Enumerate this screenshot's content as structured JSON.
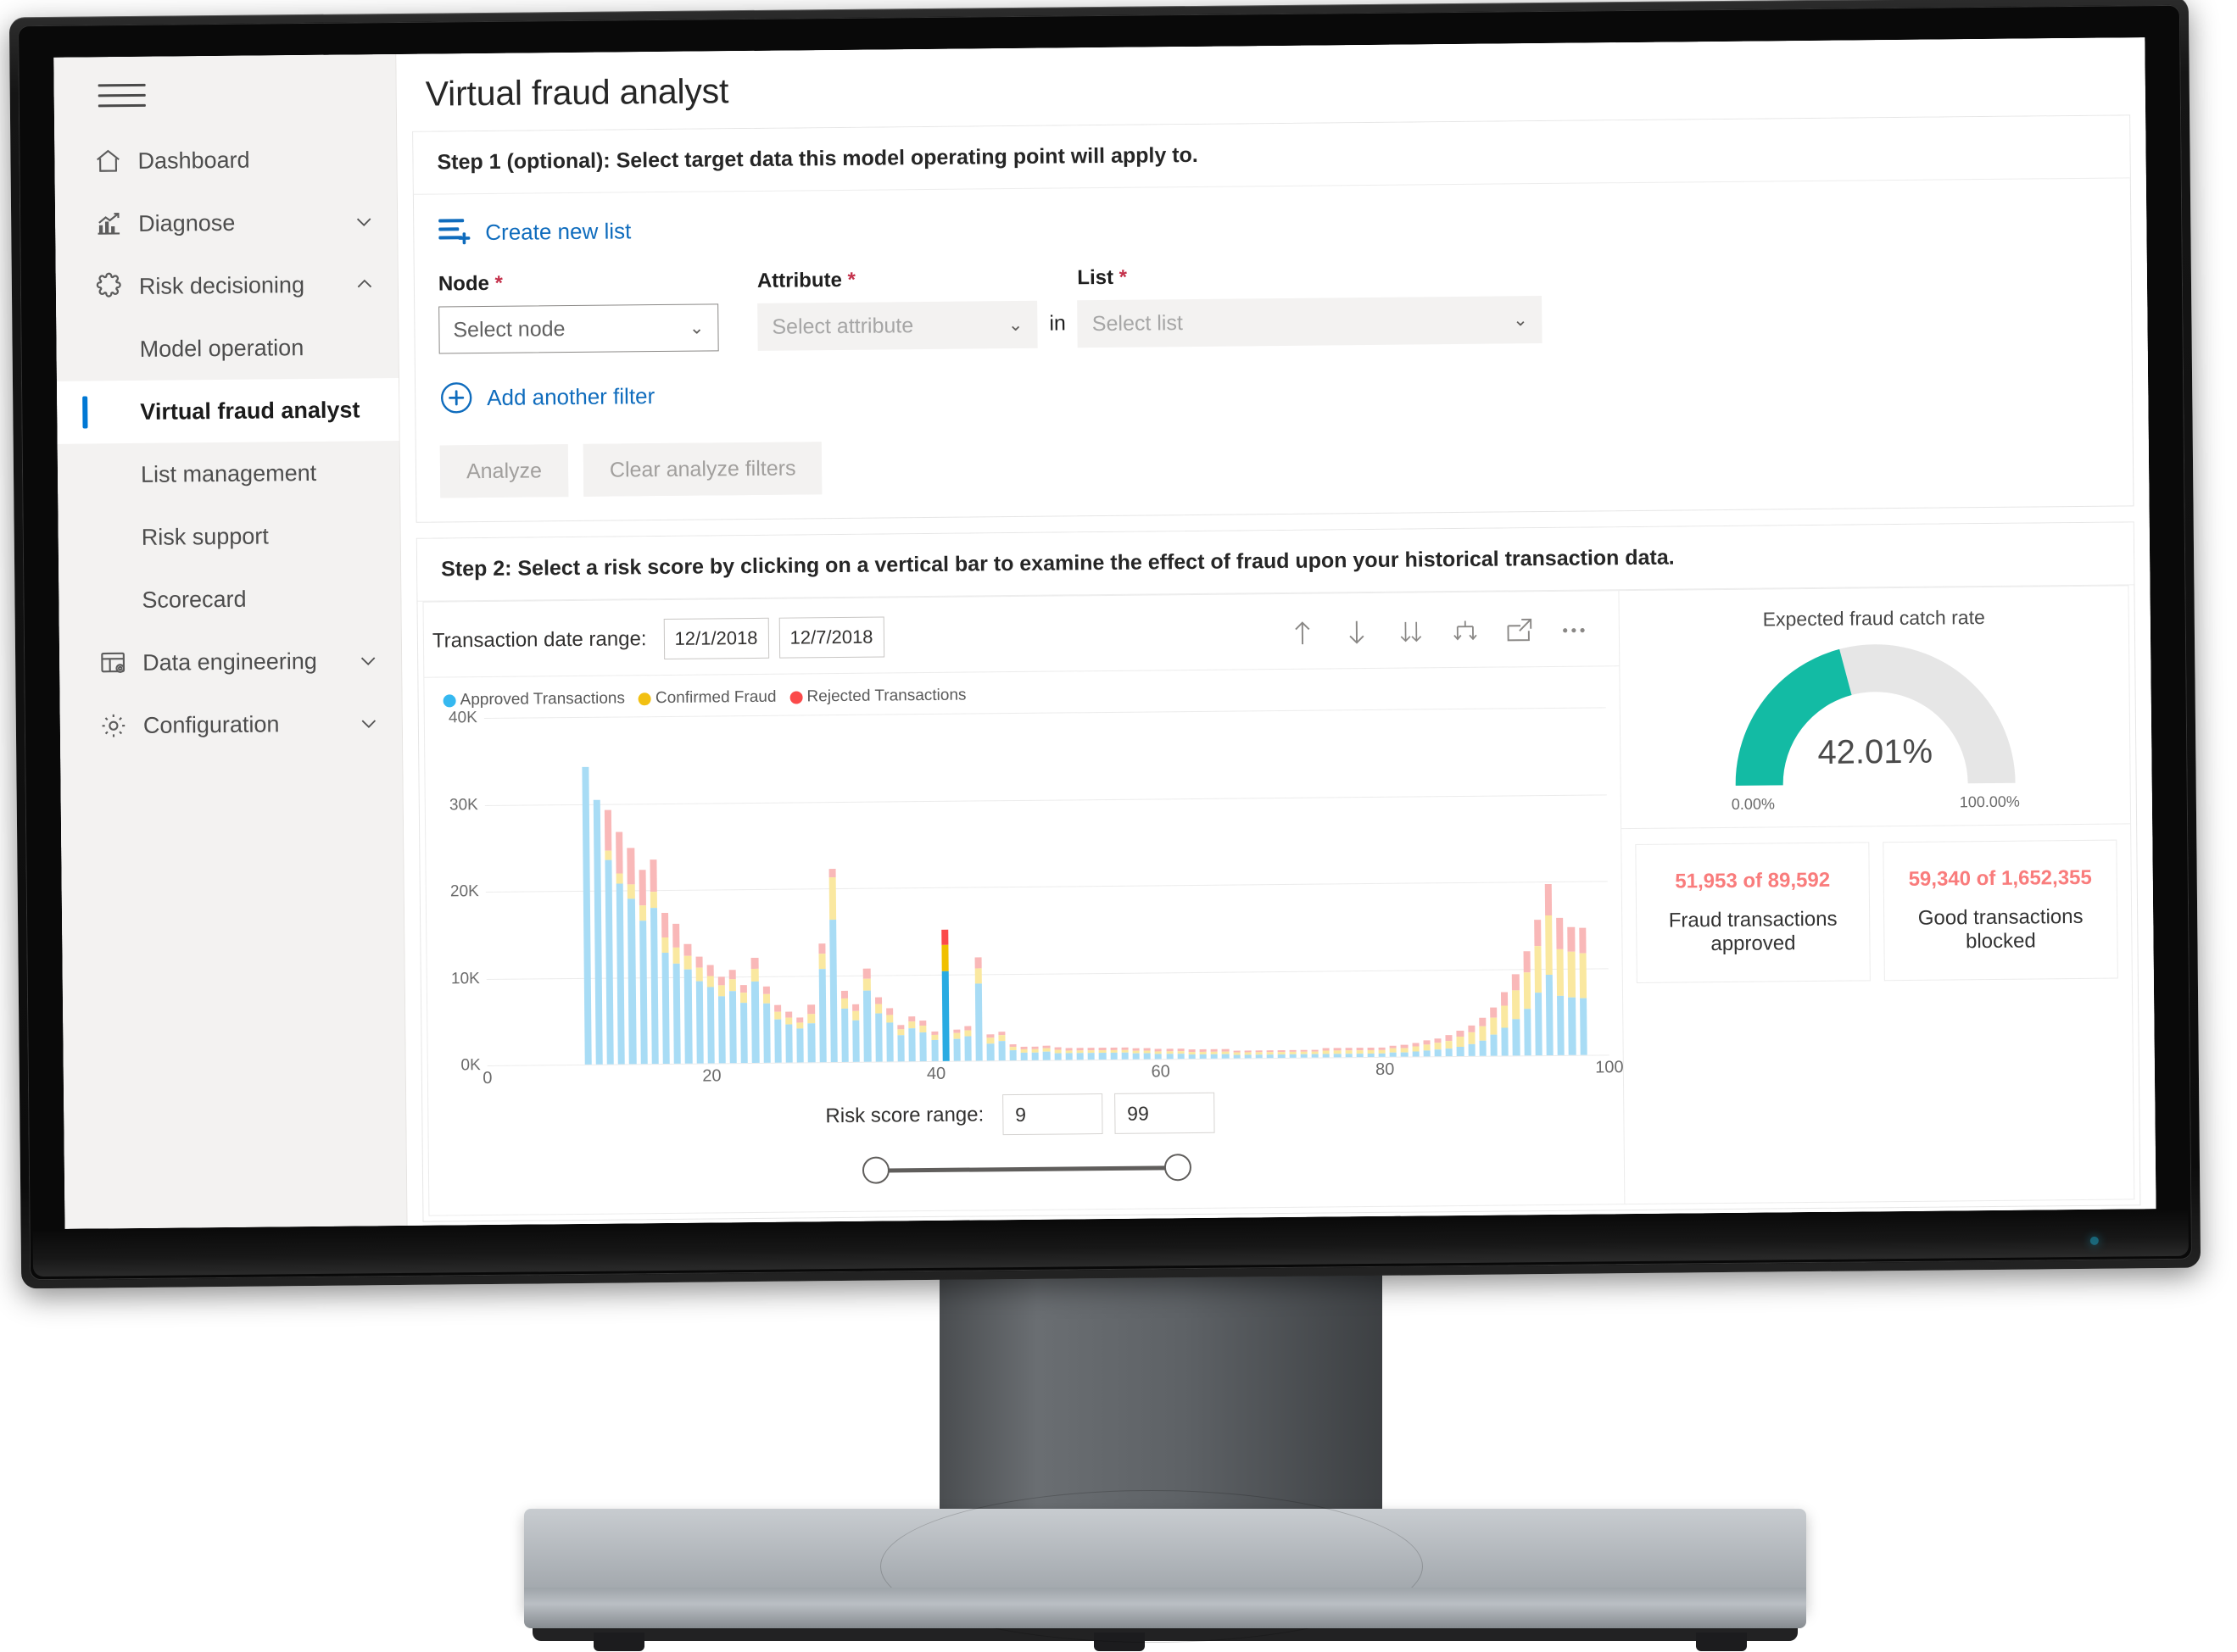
{
  "app": {
    "page_title": "Virtual fraud analyst",
    "hamburger_icon": "hamburger-menu-icon"
  },
  "sidebar": {
    "items": [
      {
        "label": "Dashboard",
        "icon": "home-icon",
        "level": "top",
        "chevron": "",
        "active": false
      },
      {
        "label": "Diagnose",
        "icon": "analytics-chart-icon",
        "level": "top",
        "chevron": "down",
        "active": false
      },
      {
        "label": "Risk decisioning",
        "icon": "puzzle-piece-icon",
        "level": "top",
        "chevron": "up",
        "active": false
      },
      {
        "label": "Model operation",
        "icon": "",
        "level": "sub",
        "chevron": "",
        "active": false
      },
      {
        "label": "Virtual fraud analyst",
        "icon": "",
        "level": "sub",
        "chevron": "",
        "active": true
      },
      {
        "label": "List management",
        "icon": "",
        "level": "sub",
        "chevron": "",
        "active": false
      },
      {
        "label": "Risk support",
        "icon": "",
        "level": "sub",
        "chevron": "",
        "active": false
      },
      {
        "label": "Scorecard",
        "icon": "",
        "level": "sub",
        "chevron": "",
        "active": false
      },
      {
        "label": "Data engineering",
        "icon": "table-settings-icon",
        "level": "top",
        "chevron": "down",
        "active": false
      },
      {
        "label": "Configuration",
        "icon": "gear-icon",
        "level": "top",
        "chevron": "down",
        "active": false
      }
    ]
  },
  "step1": {
    "heading": "Step 1 (optional): Select target data this model operating point will apply to.",
    "create_list_label": "Create new list",
    "create_list_icon": "list-add-icon",
    "node_label": "Node",
    "node_required": "*",
    "node_placeholder": "Select node",
    "attribute_label": "Attribute",
    "attribute_required": "*",
    "attribute_placeholder": "Select attribute",
    "in_word": "in",
    "list_label": "List",
    "list_required": "*",
    "list_placeholder": "Select list",
    "add_filter_label": "Add another filter",
    "add_filter_icon": "plus-circle-icon",
    "analyze_label": "Analyze",
    "clear_label": "Clear analyze filters"
  },
  "step2": {
    "heading": "Step 2: Select a risk score by clicking on a vertical bar to examine the effect of fraud upon your historical transaction data.",
    "date_range_label": "Transaction date range:",
    "date_from": "12/1/2018",
    "date_to": "12/7/2018",
    "toolbar": [
      {
        "name": "sort-ascending-icon",
        "glyph": "↑"
      },
      {
        "name": "sort-descending-icon",
        "glyph": "↓"
      },
      {
        "name": "sort-double-down-icon",
        "glyph": "↓↓"
      },
      {
        "name": "expand-branch-icon",
        "glyph": "⊥"
      },
      {
        "name": "open-in-new-icon",
        "glyph": "⇱"
      },
      {
        "name": "more-options-icon",
        "glyph": "···"
      }
    ],
    "risk_range_label": "Risk score range:",
    "risk_min": "9",
    "risk_max": "99"
  },
  "gauge": {
    "title": "Expected fraud catch rate",
    "value_text": "42.01%",
    "value": 42.01,
    "min_label": "0.00%",
    "max_label": "100.00%",
    "fill_color": "#13bba4",
    "track_color": "#e6e6e6"
  },
  "tiles": [
    {
      "value": "51,953 of 89,592",
      "label": "Fraud transactions approved"
    },
    {
      "value": "59,340 of 1,652,355",
      "label": "Good transactions blocked"
    }
  ],
  "colors": {
    "accent_blue": "#0f6cbd",
    "approved": "#a8dcf5",
    "fraud": "#fae8a0",
    "rejected": "#f9b8b8",
    "approved_sel": "#29abe2",
    "fraud_sel": "#f0c000",
    "rejected_sel": "#fb4a4a",
    "required_red": "#c4314b",
    "tile_red": "#f97c7c",
    "teal": "#13bba4"
  },
  "chart_data": {
    "type": "bar",
    "stacked": true,
    "title": "",
    "xlabel": "",
    "ylabel": "",
    "xlim": [
      0,
      100
    ],
    "ylim": [
      0,
      40000
    ],
    "xticks": [
      0,
      20,
      40,
      60,
      80,
      100
    ],
    "yticks": [
      0,
      10000,
      20000,
      30000,
      40000
    ],
    "ytick_labels": [
      "0K",
      "10K",
      "20K",
      "30K",
      "40K"
    ],
    "grid": true,
    "legend_position": "top-left",
    "selected_x": 41,
    "legend": [
      {
        "name": "Approved Transactions",
        "color": "#35b8f0"
      },
      {
        "name": "Confirmed Fraud",
        "color": "#f2c012"
      },
      {
        "name": "Rejected Transactions",
        "color": "#fb4a4a"
      }
    ],
    "x": [
      9,
      10,
      11,
      12,
      13,
      14,
      15,
      16,
      17,
      18,
      19,
      20,
      21,
      22,
      23,
      24,
      25,
      26,
      27,
      28,
      29,
      30,
      31,
      32,
      33,
      34,
      35,
      36,
      37,
      38,
      39,
      40,
      41,
      42,
      43,
      44,
      45,
      46,
      47,
      48,
      49,
      50,
      51,
      52,
      53,
      54,
      55,
      56,
      57,
      58,
      59,
      60,
      61,
      62,
      63,
      64,
      65,
      66,
      67,
      68,
      69,
      70,
      71,
      72,
      73,
      74,
      75,
      76,
      77,
      78,
      79,
      80,
      81,
      82,
      83,
      84,
      85,
      86,
      87,
      88,
      89,
      90,
      91,
      92,
      93,
      94,
      95,
      96,
      97,
      98,
      99
    ],
    "series": [
      {
        "name": "Approved Transactions",
        "color": "#a8dcf5",
        "values": [
          34200,
          30400,
          23500,
          20800,
          19000,
          16500,
          18000,
          12800,
          11500,
          10800,
          9500,
          8800,
          7700,
          8300,
          6900,
          9400,
          6800,
          5000,
          4400,
          3900,
          4500,
          10700,
          16400,
          6100,
          4800,
          8200,
          5600,
          4500,
          3000,
          3800,
          3300,
          2400,
          10300,
          2500,
          2800,
          8900,
          2000,
          2200,
          1200,
          900,
          900,
          1000,
          800,
          800,
          800,
          800,
          800,
          800,
          800,
          700,
          700,
          600,
          600,
          600,
          500,
          500,
          500,
          500,
          400,
          400,
          400,
          400,
          400,
          400,
          400,
          400,
          400,
          400,
          400,
          400,
          400,
          400,
          500,
          500,
          600,
          700,
          800,
          900,
          1100,
          1400,
          1800,
          2400,
          3200,
          4200,
          5400,
          7200,
          9300,
          6800,
          6600,
          6500
        ]
      },
      {
        "name": "Confirmed Fraud",
        "color": "#fae8a0",
        "values": [
          0,
          0,
          1100,
          1200,
          1700,
          1700,
          1800,
          1700,
          1900,
          1600,
          1500,
          1300,
          1300,
          1400,
          1200,
          1400,
          1100,
          900,
          800,
          700,
          1100,
          1800,
          4900,
          1200,
          1100,
          1400,
          1000,
          900,
          700,
          800,
          800,
          600,
          3100,
          700,
          700,
          1700,
          600,
          700,
          400,
          400,
          400,
          400,
          400,
          300,
          300,
          300,
          300,
          300,
          300,
          300,
          300,
          300,
          300,
          300,
          300,
          300,
          300,
          300,
          300,
          300,
          300,
          300,
          300,
          300,
          300,
          300,
          400,
          400,
          400,
          400,
          400,
          400,
          500,
          500,
          600,
          700,
          800,
          900,
          1100,
          1300,
          1600,
          2000,
          2600,
          3300,
          4200,
          5400,
          6800,
          5400,
          5300,
          5200
        ]
      },
      {
        "name": "Rejected Transactions",
        "color": "#f9b8b8",
        "values": [
          0,
          0,
          4700,
          4700,
          4200,
          4100,
          3700,
          2900,
          2700,
          1400,
          1300,
          1200,
          1000,
          1000,
          900,
          1300,
          900,
          700,
          700,
          600,
          1000,
          1200,
          900,
          900,
          700,
          1100,
          800,
          700,
          500,
          600,
          600,
          400,
          1700,
          400,
          500,
          1300,
          400,
          400,
          300,
          300,
          300,
          300,
          300,
          300,
          300,
          300,
          300,
          300,
          300,
          300,
          300,
          300,
          300,
          300,
          300,
          300,
          300,
          300,
          200,
          200,
          200,
          200,
          200,
          200,
          200,
          200,
          300,
          300,
          300,
          300,
          300,
          300,
          300,
          400,
          400,
          500,
          500,
          600,
          700,
          800,
          1000,
          1200,
          1500,
          1900,
          2400,
          3000,
          3600,
          3600,
          2800,
          2900
        ]
      }
    ]
  }
}
